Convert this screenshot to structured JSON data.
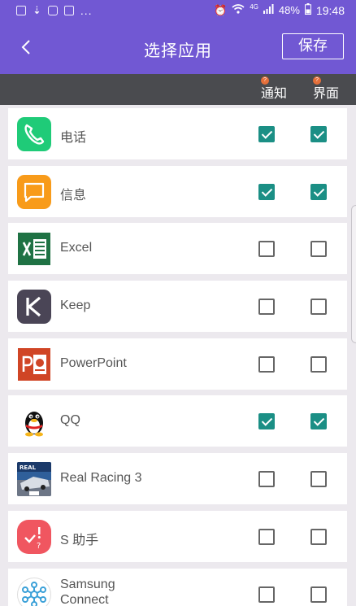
{
  "status_bar": {
    "battery": "48%",
    "time": "19:48",
    "network": "4G"
  },
  "header": {
    "title": "选择应用",
    "save_label": "保存"
  },
  "columns": {
    "notify": "通知",
    "ui": "界面"
  },
  "apps": [
    {
      "name": "电话",
      "icon": "phone-icon",
      "notify": true,
      "ui": true
    },
    {
      "name": "信息",
      "icon": "message-icon",
      "notify": true,
      "ui": true
    },
    {
      "name": "Excel",
      "icon": "excel-icon",
      "notify": false,
      "ui": false
    },
    {
      "name": "Keep",
      "icon": "keep-icon",
      "notify": false,
      "ui": false
    },
    {
      "name": "PowerPoint",
      "icon": "powerpoint-icon",
      "notify": false,
      "ui": false
    },
    {
      "name": "QQ",
      "icon": "qq-penguin-icon",
      "notify": true,
      "ui": true
    },
    {
      "name": "Real Racing 3",
      "icon": "real-racing-icon",
      "notify": false,
      "ui": false
    },
    {
      "name": "S 助手",
      "icon": "s-assistant-icon",
      "notify": false,
      "ui": false
    },
    {
      "name": "Samsung Connect",
      "icon": "samsung-connect-icon",
      "notify": false,
      "ui": false
    }
  ],
  "colors": {
    "primary": "#7158d3",
    "column_header": "#4a4b4f",
    "checked": "#1b8f85",
    "badge": "#e46f3a"
  }
}
